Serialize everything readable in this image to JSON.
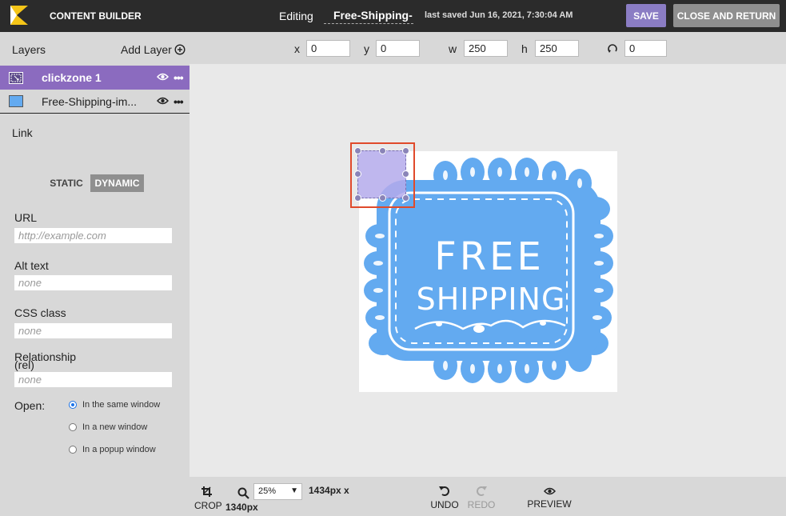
{
  "app": {
    "title": "CONTENT BUILDER",
    "editing_label": "Editing",
    "document_name": "Free-Shipping-",
    "last_saved": "last saved Jun 16, 2021, 7:30:04 AM"
  },
  "header": {
    "save_label": "SAVE",
    "close_label": "CLOSE AND RETURN"
  },
  "layers": {
    "title": "Layers",
    "add_label": "Add Layer",
    "items": [
      {
        "name": "clickzone 1",
        "selected": true
      },
      {
        "name": "Free-Shipping-im...",
        "selected": false
      }
    ]
  },
  "link": {
    "section_title": "Link",
    "static_label": "STATIC",
    "dynamic_label": "DYNAMIC",
    "fields": {
      "url": {
        "label": "URL",
        "placeholder": "http://example.com"
      },
      "alt": {
        "label": "Alt text",
        "placeholder": "none"
      },
      "css": {
        "label": "CSS class",
        "placeholder": "none"
      },
      "rel": {
        "label_line1": "Relationship",
        "label_line2": "(rel)",
        "placeholder": "none"
      }
    },
    "open_label": "Open:",
    "open_options": [
      "In the same window",
      "In a new window",
      "In a popup window"
    ],
    "open_selected": "In the same window"
  },
  "geometry": {
    "x_label": "x",
    "x": "0",
    "y_label": "y",
    "y": "0",
    "w_label": "w",
    "w": "250",
    "h_label": "h",
    "h": "250",
    "rotation": "0"
  },
  "artwork": {
    "line1": "FREE",
    "line2": "SHIPPING",
    "color": "#63aaf0"
  },
  "toolbar": {
    "crop": "CROP",
    "zoom": "25%",
    "size_line1": "1434px x",
    "size_line2": "1340px",
    "undo": "UNDO",
    "redo": "REDO",
    "preview": "PREVIEW"
  },
  "colors": {
    "accent": "#8b6bbf",
    "selection": "#e04a2b",
    "topbar": "#2b2b2b"
  }
}
